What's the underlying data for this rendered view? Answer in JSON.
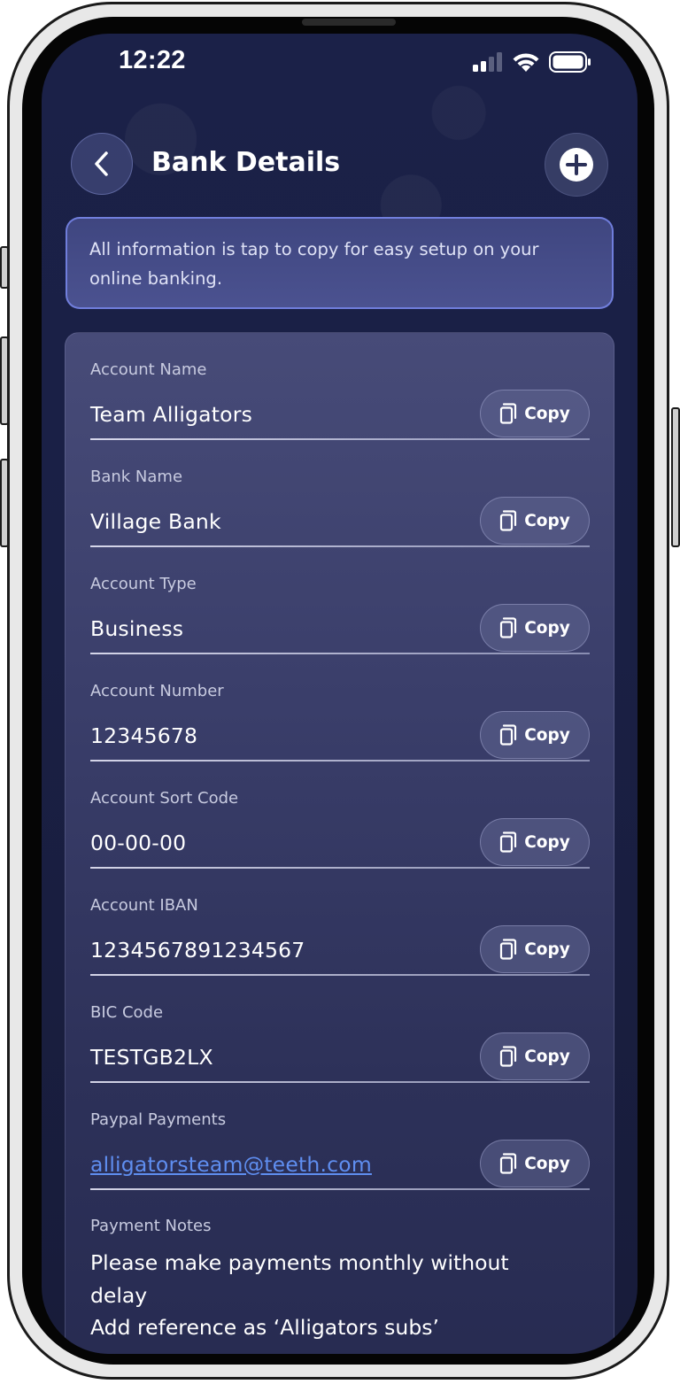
{
  "status_bar": {
    "time": "12:22",
    "icons": [
      "signal-icon",
      "wifi-icon",
      "battery-icon"
    ]
  },
  "header": {
    "title": "Bank Details",
    "back_icon": "chevron-left-icon",
    "add_icon": "plus-circle-icon"
  },
  "info_banner": {
    "text": "All information is tap to copy for easy setup on your online banking."
  },
  "fields": [
    {
      "label": "Account Name",
      "value": "Team Alligators",
      "button": "Copy"
    },
    {
      "label": "Bank Name",
      "value": "Village Bank",
      "button": "Copy"
    },
    {
      "label": "Account Type",
      "value": "Business",
      "button": "Copy"
    },
    {
      "label": "Account Number",
      "value": "12345678",
      "button": "Copy"
    },
    {
      "label": "Account Sort Code",
      "value": "00-00-00",
      "button": "Copy"
    },
    {
      "label": "Account IBAN",
      "value": "1234567891234567",
      "button": "Copy"
    },
    {
      "label": "BIC Code",
      "value": "TESTGB2LX",
      "button": "Copy"
    },
    {
      "label": "Paypal Payments",
      "value": "alligatorsteam@teeth.com",
      "button": "Copy"
    }
  ],
  "payment_notes": {
    "label": "Payment Notes",
    "text": "Please make payments monthly without delay\nAdd reference as ‘Alligators subs’"
  },
  "colors": {
    "background": "#1a2045",
    "banner_border": "#7887eb",
    "link": "#5f8ef0",
    "text": "#ffffff"
  }
}
